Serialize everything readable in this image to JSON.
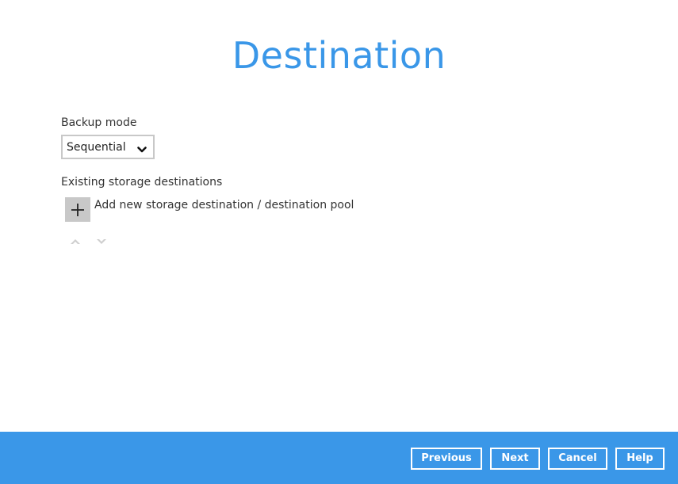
{
  "page": {
    "title": "Destination"
  },
  "backup_mode": {
    "label": "Backup mode",
    "selected": "Sequential",
    "icon": "chevron-down-icon"
  },
  "destinations": {
    "label": "Existing storage destinations",
    "add_label": "Add new storage destination / destination pool",
    "add_icon": "plus-icon",
    "move_up_icon": "move-up-icon",
    "move_down_icon": "move-down-icon"
  },
  "footer": {
    "previous_label": "Previous",
    "next_label": "Next",
    "cancel_label": "Cancel",
    "help_label": "Help"
  },
  "colors": {
    "accent": "#3a97e8",
    "icon_bg": "#c8c8c8",
    "text": "#333333"
  }
}
